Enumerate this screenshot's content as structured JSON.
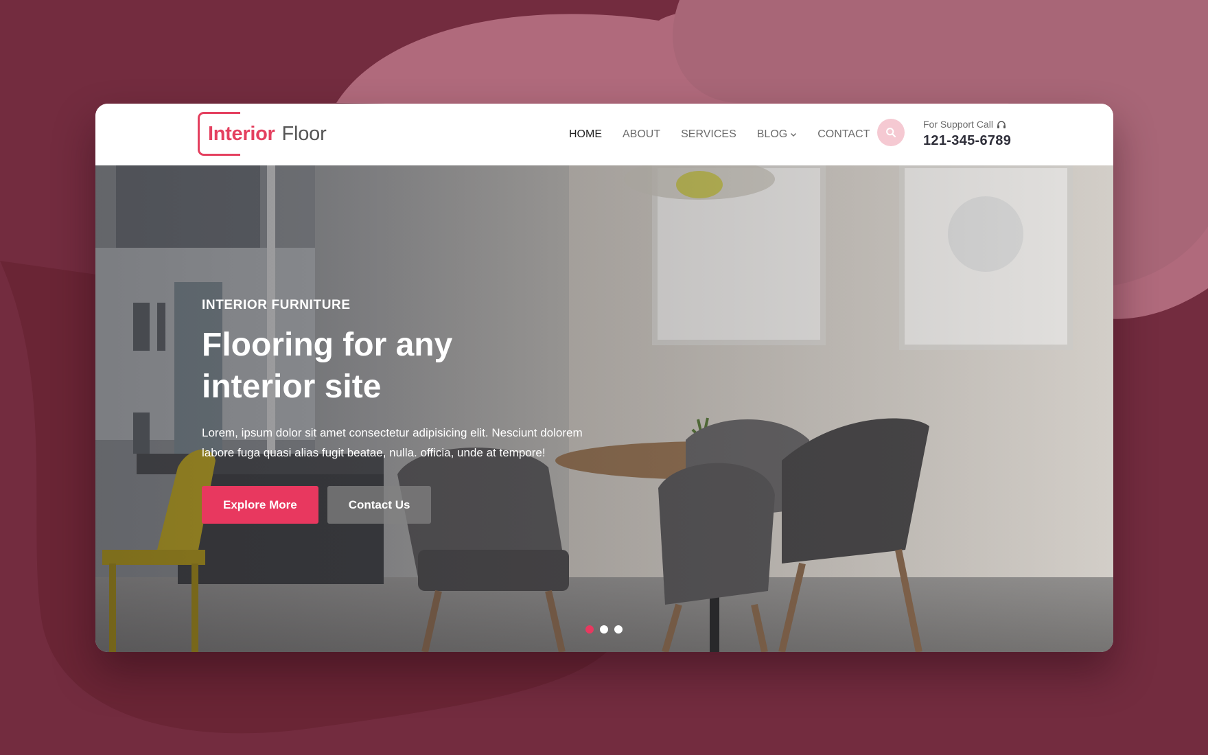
{
  "colors": {
    "background": "#732c3f",
    "accent": "#e8385f",
    "brand": "#e4405f",
    "header_bg": "#ffffff"
  },
  "logo": {
    "word1": "Interior",
    "word2": "Floor"
  },
  "nav": {
    "items": [
      {
        "label": "HOME",
        "active": true
      },
      {
        "label": "ABOUT",
        "active": false
      },
      {
        "label": "SERVICES",
        "active": false
      },
      {
        "label": "BLOG",
        "active": false,
        "has_dropdown": true
      },
      {
        "label": "CONTACT",
        "active": false
      }
    ]
  },
  "search": {
    "icon": "search-icon"
  },
  "support": {
    "label": "For Support Call",
    "icon": "headphones-icon",
    "phone": "121-345-6789"
  },
  "hero": {
    "eyebrow": "INTERIOR FURNITURE",
    "headline_line1": "Flooring for any",
    "headline_line2": "interior site",
    "lede": "Lorem, ipsum dolor sit amet consectetur adipisicing elit. Nesciunt dolorem labore fuga quasi alias fugit beatae, nulla. officia, unde at tempore!",
    "primary_cta": "Explore More",
    "secondary_cta": "Contact Us",
    "slides": {
      "count": 3,
      "active_index": 0
    }
  }
}
